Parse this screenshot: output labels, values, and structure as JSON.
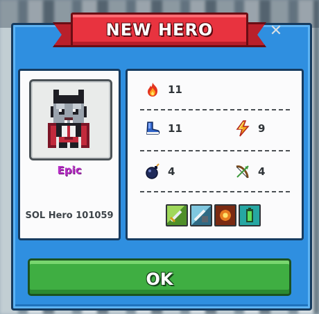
{
  "dialog": {
    "title": "NEW HERO",
    "close_glyph": "✕"
  },
  "hero": {
    "rarity": "Epic",
    "name": "SOL Hero 101059",
    "rarity_color": "#b82fc7"
  },
  "stats": {
    "fire": {
      "icon": "fire-icon",
      "value": "11"
    },
    "speed": {
      "icon": "boot-icon",
      "value": "11"
    },
    "power": {
      "icon": "lightning-icon",
      "value": "9"
    },
    "bombs": {
      "icon": "bomb-icon",
      "value": "4"
    },
    "range": {
      "icon": "bow-icon",
      "value": "4"
    }
  },
  "skills": [
    "sword-skill-icon",
    "sword-armor-skill-icon",
    "explosion-skill-icon",
    "battery-skill-icon"
  ],
  "actions": {
    "ok_label": "OK"
  },
  "colors": {
    "dialog_blue": "#2f8fe0",
    "ribbon_red": "#e8333f",
    "ok_green": "#3fae42"
  }
}
